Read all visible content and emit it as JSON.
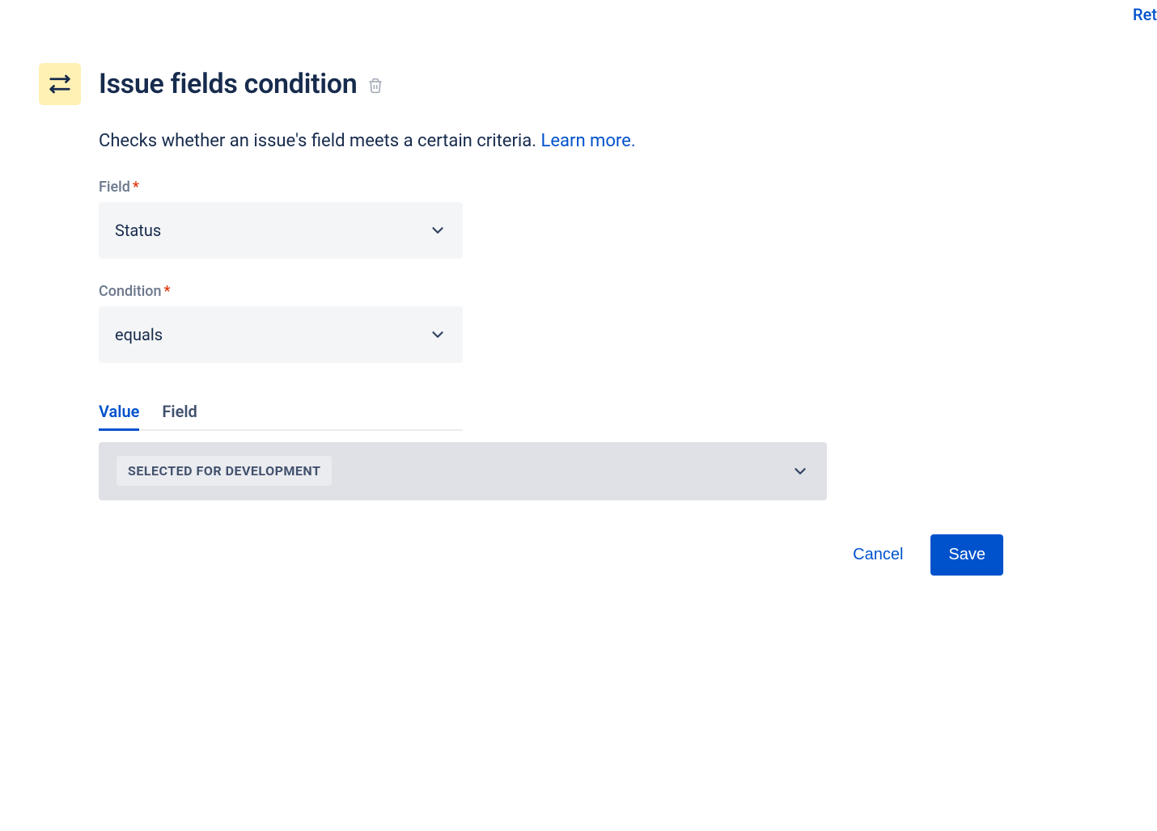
{
  "top_right": "Ret",
  "header": {
    "title": "Issue fields condition"
  },
  "description": {
    "text": "Checks whether an issue's field meets a certain criteria.",
    "link_label": "Learn more."
  },
  "form": {
    "field_label": "Field",
    "field_value": "Status",
    "condition_label": "Condition",
    "condition_value": "equals"
  },
  "tabs": {
    "value": "Value",
    "field": "Field"
  },
  "value_selection": "SELECTED FOR DEVELOPMENT",
  "buttons": {
    "cancel": "Cancel",
    "save": "Save"
  }
}
